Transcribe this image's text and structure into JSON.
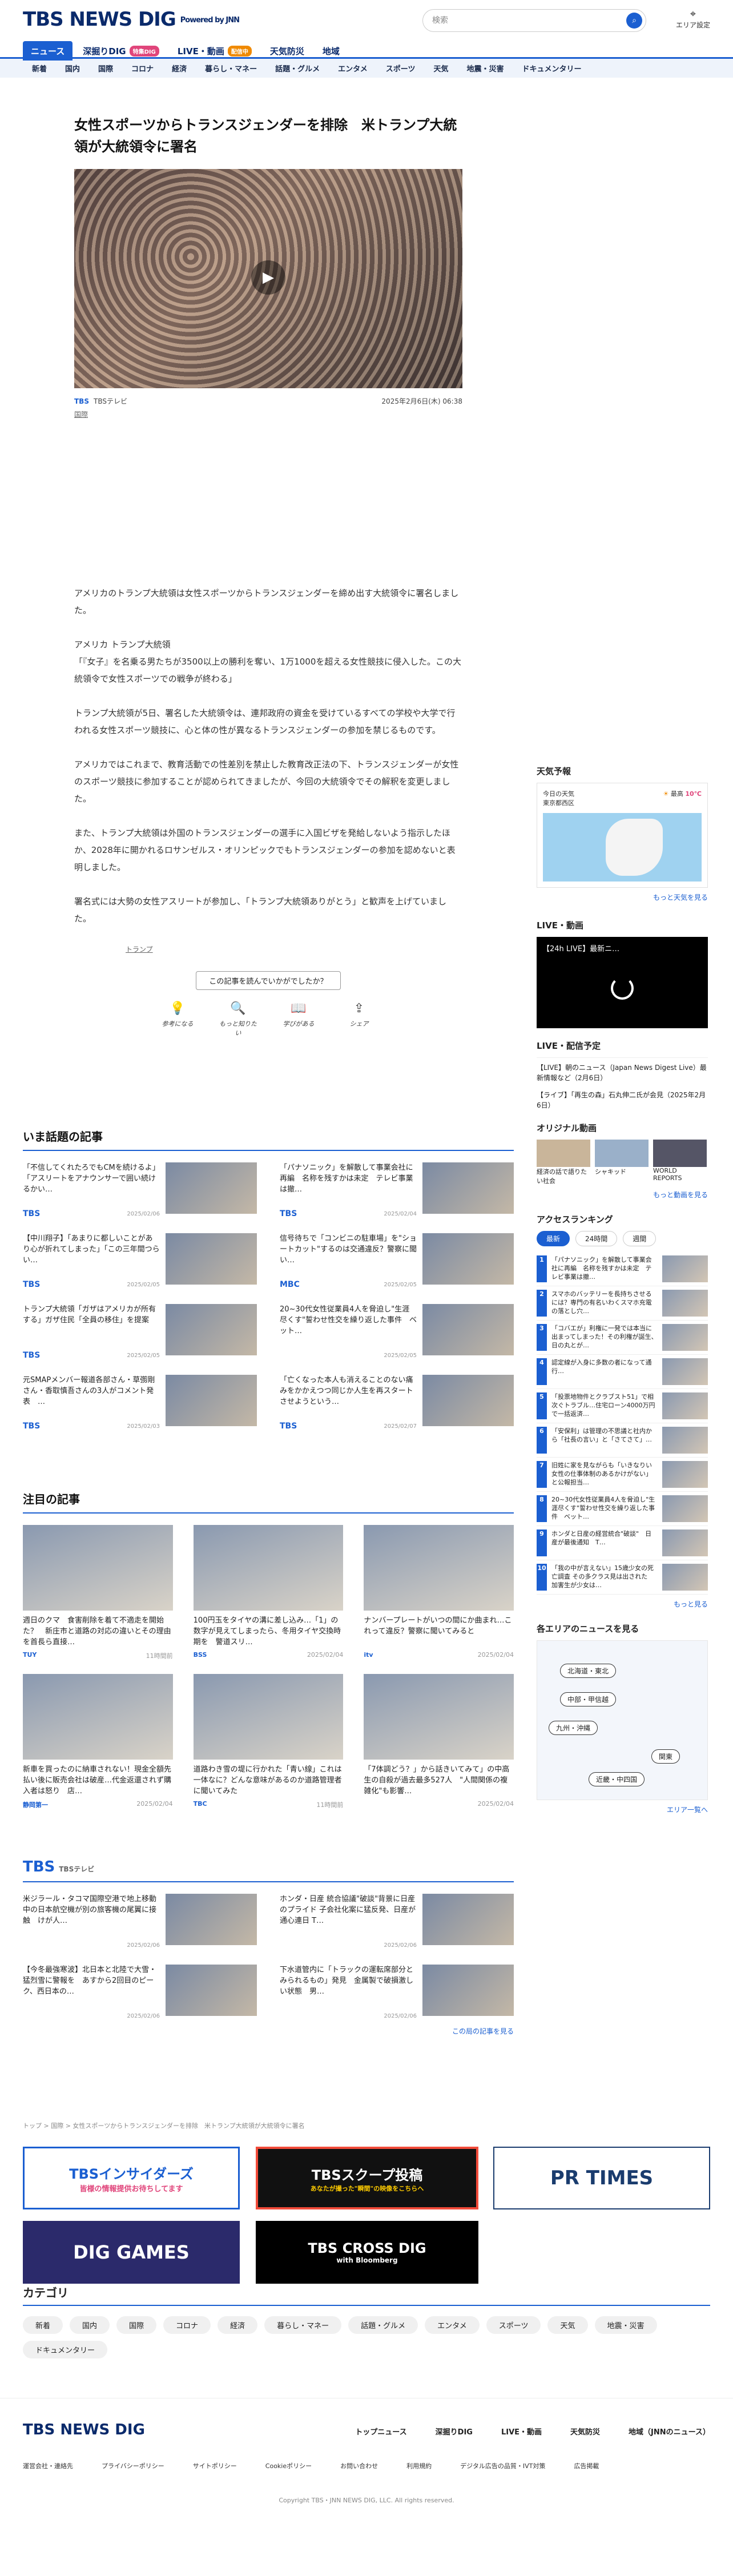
{
  "header": {
    "logo": "TBS NEWS DIG",
    "powered": "Powered by JNN",
    "search_placeholder": "検索",
    "area_label": "エリア設定",
    "tabs": [
      {
        "label": "ニュース",
        "badge": ""
      },
      {
        "label": "深掘りDIG",
        "badge": "特集DIG"
      },
      {
        "label": "LIVE・動画",
        "badge": ""
      },
      {
        "label": "",
        "badge": "配信中"
      },
      {
        "label": "天気防災",
        "badge": ""
      },
      {
        "label": "地域",
        "badge": ""
      }
    ],
    "subnav": [
      "新着",
      "国内",
      "国際",
      "コロナ",
      "経済",
      "暮らし・マネー",
      "話題・グルメ",
      "エンタメ",
      "スポーツ",
      "天気",
      "地震・災害",
      "ドキュメンタリー"
    ]
  },
  "article": {
    "title": "女性スポーツからトランスジェンダーを排除　米トランプ大統領が大統領令に署名",
    "source": "TBS",
    "source_name": "TBSテレビ",
    "date": "2025年2月6日(木) 06:38",
    "category": "国際",
    "paragraphs": [
      "アメリカのトランプ大統領は女性スポーツからトランスジェンダーを締め出す大統領令に署名しました。",
      "アメリカ トランプ大統領\n「『女子』を名乗る男たちが3500以上の勝利を奪い、1万1000を超える女性競技に侵入した。この大統領令で女性スポーツでの戦争が終わる」",
      "トランプ大統領が5日、署名した大統領令は、連邦政府の資金を受けているすべての学校や大学で行われる女性スポーツ競技に、心と体の性が異なるトランスジェンダーの参加を禁じるものです。",
      "アメリカではこれまで、教育活動での性差別を禁止した教育改正法の下、トランスジェンダーが女性のスポーツ競技に参加することが認められてきましたが、今回の大統領令でその解釈を変更しました。",
      "また、トランプ大統領は外国のトランスジェンダーの選手に入国ビザを発給しないよう指示したほか、2028年に開かれるロサンゼルス・オリンピックでもトランスジェンダーの参加を認めないと表明しました。",
      "署名式には大勢の女性アスリートが参加し、「トランプ大統領ありがとう」と歓声を上げていました。"
    ],
    "tag": "トランプ",
    "feedback_q": "この記事を読んでいかがでしたか？",
    "reactions": [
      "参考になる",
      "もっと知りたい",
      "学びがある",
      "シェア"
    ]
  },
  "trending": {
    "title": "いま話題の記事",
    "items": [
      {
        "t": "「不信してくれたろでもCMを続けるよ」「アスリートをアナウンサーで囲い続けるかい…",
        "s": "TBS",
        "d": "2025/02/06"
      },
      {
        "t": "「パナソニック」を解散して事業会社に再編　名称を残すかは未定　テレビ事業は撤…",
        "s": "TBS",
        "d": "2025/02/04"
      },
      {
        "t": "【中川翔子】「あまりに都しいことがあり心が折れてしまった」「この三年間つらい…",
        "s": "TBS",
        "d": "2025/02/05"
      },
      {
        "t": "信号待ちで「コンビニの駐車場」を\"ショートカット\"するのは交通違反？警察に聞い…",
        "s": "MBC",
        "d": "2025/02/05"
      },
      {
        "t": "トランプ大統領「ガザはアメリカが所有する」ガザ住民「全員の移住」を提案",
        "s": "TBS",
        "d": "2025/02/05"
      },
      {
        "t": "20~30代女性従業員4人を脅迫し\"生涯尽くす\"誓わせ性交を繰り返した事件　ベット…",
        "s": "",
        "d": "2025/02/05"
      },
      {
        "t": "元SMAPメンバー報道各部さん・草彅剛さん・香取慎吾さんの3人がコメント発表　…",
        "s": "TBS",
        "d": "2025/02/03"
      },
      {
        "t": "「亡くなった本人も消えることのない痛みをかかえつつ同じか人生を再スタートさせようという…",
        "s": "TBS",
        "d": "2025/02/07"
      }
    ]
  },
  "featured": {
    "title": "注目の記事",
    "items": [
      {
        "t": "週日のクマ　食害削除を着て不適走を開始た？　新庄市と道路の対応の違いとその理由を首長ら直接…",
        "s": "TUY",
        "d": "11時間前"
      },
      {
        "t": "100円玉をタイヤの溝に差し込み…「1」の数字が見えてしまったら、冬用タイヤ交換時期を　警道スリ…",
        "s": "BSS",
        "d": "2025/02/04"
      },
      {
        "t": "ナンバープレートがいつの間にか曲まれ…これって違反？警察に聞いてみると",
        "s": "itv",
        "d": "2025/02/04"
      },
      {
        "t": "新車を買ったのに納車されない！現金全額先払い後に販売会社は破産…代金返還されず購入者は怒り　店…",
        "s": "静岡第一",
        "d": "2025/02/04"
      },
      {
        "t": "道路わき雪の堤に行かれた「青い線」これは一体なに？どんな意味があるのか道路管理者に聞いてみた",
        "s": "TBC",
        "d": "11時間前"
      },
      {
        "t": "「7体調どう？」から話きいてみて」の中高生の自殺が過去最多527人　\"人間関係の複雑化\"も影響…",
        "s": "",
        "d": "2025/02/04"
      }
    ]
  },
  "tbs": {
    "title": "TBS",
    "subtitle": "TBSテレビ",
    "items": [
      {
        "t": "米ジラール・タコマ国際空港で地上移動中の日本航空機が別の旅客機の尾翼に接触　けが人…",
        "d": "2025/02/06"
      },
      {
        "t": "ホンダ・日産 統合協議\"破談\"背景に日産のプライド 子会社化案に猛反発、日産が通心連日 T…",
        "d": "2025/02/06"
      },
      {
        "t": "【今冬最強寒波】北日本と北陸で大雪・猛烈雪に警報を　あすから2回目のピーク、西日本の…",
        "d": "2025/02/06"
      },
      {
        "t": "下水道管内に「トラックの運転席部分とみられるもの」発見　金属製で破損激しい状態　男…",
        "d": "2025/02/06"
      }
    ],
    "more": "この局の記事を見る"
  },
  "sidebar": {
    "weather_title": "天気予報",
    "weather_today": "今日の天気",
    "weather_region": "東京都西区",
    "weather_high": "最高",
    "weather_temp": "10℃",
    "weather_more": "もっと天気を見る",
    "live_title": "LIVE・動画",
    "live_label": "【24h LIVE】最新ニ…",
    "sched_title": "LIVE・配信予定",
    "sched": [
      "【LIVE】朝のニュース（Japan News Digest Live）最新情報など（2月6日）",
      "【ライブ】「再生の森」石丸伸二氏が会見（2025年2月6日）"
    ],
    "orig_title": "オリジナル動画",
    "orig": [
      "経済の話で語りたい社会",
      "シャキッド",
      "WORLD REPORTS"
    ],
    "orig_more": "もっと動画を見る",
    "rank_title": "アクセスランキング",
    "rank_tabs": [
      "最新",
      "24時間",
      "週間"
    ],
    "ranks": [
      "「パナソニック」を解散して事業会社に再編　名称を残すかは未定　テレビ事業は撤…",
      "スマホのバッテリーを長持ちさせるには？専門の有名いわくスマホ充電の落とし穴…",
      "「コバエが」利権に一発では本当に出まってしまった！その利権が誕生、日の丸とが…",
      "認定線が入身に多数の者になって通行…",
      "「投票地物件とクラブスト51」で相次ぐトラブル…住宅ローン4000万円で一括返済…",
      "「安保利」は管理の不思議と社内から「社長の言い」と「さてさて」…",
      "旧姓に家を見ながらも「いきなりい女性の仕事体制のあるかけがない」と公報担当…",
      "20~30代女性従業員4人を脅迫し\"生涯尽くす\"誓わせ性交を繰り返した事件　ベット…",
      "ホンダと日産の経営統合\"破談\"　日産が最後通知　T…",
      "「我の中が言えない」15歳少女の死亡調査 その多クラス見は出された　加害生が少女は…"
    ],
    "rank_more": "もっと見る",
    "area_title": "各エリアのニュースを見る",
    "areas": [
      "北海道・東北",
      "中部・甲信越",
      "九州・沖縄",
      "関東",
      "近畿・中四国"
    ],
    "area_more": "エリア一覧へ"
  },
  "breadcrumb": "トップ > 国際 > 女性スポーツからトランスジェンダーを排除　米トランプ大統領が大統領令に署名",
  "banners": {
    "b1": "TBSインサイダーズ",
    "b1sub": "皆様の情報提供お待ちしてます",
    "b2": "TBSスクープ投稿",
    "b2sub": "あなたが撮った\"瞬間\"の映像をこちらへ",
    "b3": "PR TIMES",
    "b4": "DIG GAMES",
    "b5": "TBS CROSS DIG",
    "b5sub": "with Bloomberg"
  },
  "categories": {
    "title": "カテゴリ",
    "items": [
      "新着",
      "国内",
      "国際",
      "コロナ",
      "経済",
      "暮らし・マネー",
      "話題・グルメ",
      "エンタメ",
      "スポーツ",
      "天気",
      "地震・災害",
      "ドキュメンタリー"
    ]
  },
  "footer": {
    "logo": "TBS NEWS DIG",
    "nav": [
      "トップニュース",
      "深掘りDIG",
      "LIVE・動画",
      "天気防災",
      "地域（JNNのニュース）"
    ],
    "links": [
      "運営会社・連絡先",
      "プライバシーポリシー",
      "サイトポリシー",
      "Cookieポリシー",
      "お問い合わせ",
      "利用規約",
      "デジタル広告の品質・IVT対策",
      "広告掲載"
    ],
    "copy": "Copyright TBS・JNN NEWS DIG, LLC. All rights reserved."
  },
  "colors": {
    "brand": "#1b5fd1",
    "navy": "#0a2a6b"
  }
}
